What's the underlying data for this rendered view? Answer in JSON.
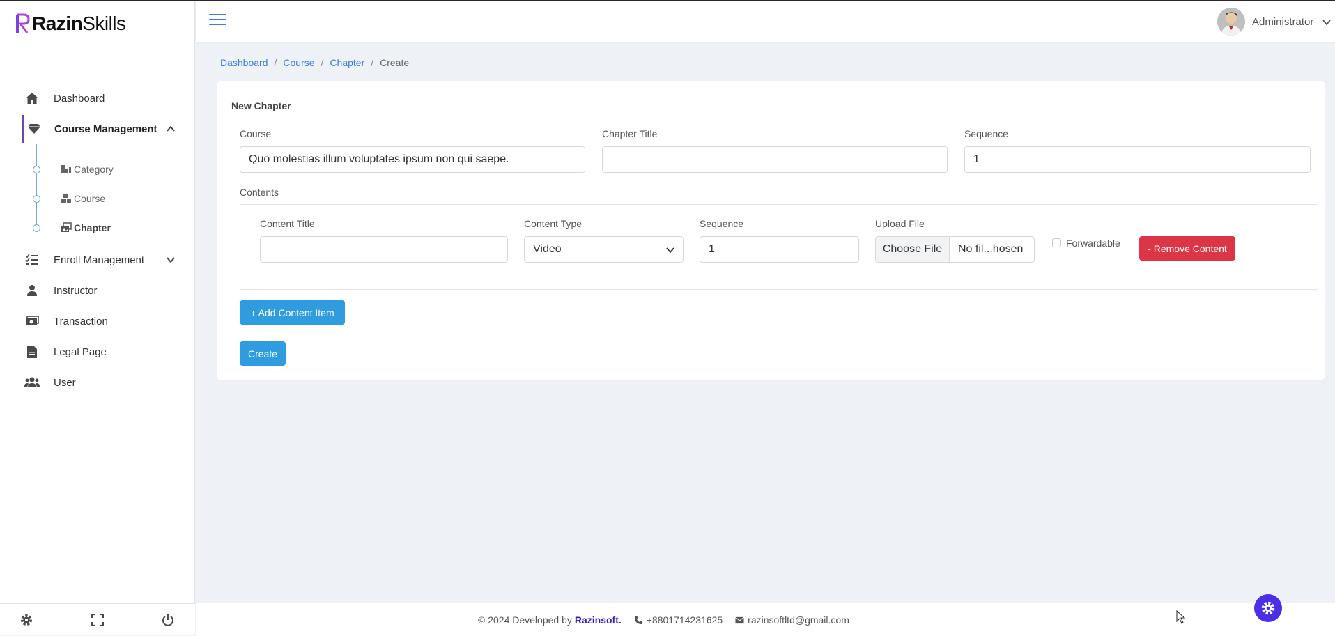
{
  "app": {
    "logo_brand": "Razin",
    "logo_suffix": "Skills"
  },
  "sidebar": {
    "items": [
      {
        "label": "Dashboard",
        "icon": "home-icon"
      },
      {
        "label": "Course Management",
        "icon": "gem-icon",
        "expanded": true
      },
      {
        "label": "Enroll Management",
        "icon": "list-check-icon",
        "expanded": false
      },
      {
        "label": "Instructor",
        "icon": "user-icon"
      },
      {
        "label": "Transaction",
        "icon": "money-icon"
      },
      {
        "label": "Legal Page",
        "icon": "file-icon"
      },
      {
        "label": "User",
        "icon": "users-icon"
      }
    ],
    "sub_items": [
      {
        "label": "Category",
        "icon": "category-icon"
      },
      {
        "label": "Course",
        "icon": "boxes-icon"
      },
      {
        "label": "Chapter",
        "icon": "images-icon",
        "active": true
      }
    ]
  },
  "topbar": {
    "user_name": "Administrator"
  },
  "breadcrumb": {
    "items": [
      "Dashboard",
      "Course",
      "Chapter"
    ],
    "current": "Create"
  },
  "form": {
    "title": "New Chapter",
    "course_label": "Course",
    "course_value": "Quo molestias illum voluptates ipsum non qui saepe.",
    "chapter_title_label": "Chapter Title",
    "chapter_title_value": "",
    "sequence_label": "Sequence",
    "sequence_value": "1",
    "contents_label": "Contents",
    "content_item": {
      "title_label": "Content Title",
      "title_value": "",
      "type_label": "Content Type",
      "type_value": "Video",
      "sequence_label": "Sequence",
      "sequence_value": "1",
      "upload_label": "Upload File",
      "choose_file": "Choose File",
      "file_name": "No fil...hosen",
      "forwardable_label": "Forwardable",
      "forwardable_checked": false,
      "remove_label": "- Remove Content"
    },
    "add_content_label": "+ Add Content Item",
    "create_label": "Create"
  },
  "footer": {
    "copyright": "© 2024 Developed by",
    "company": "Razinsoft.",
    "phone": "+8801714231625",
    "email": "razinsoftltd@gmail.com"
  },
  "colors": {
    "accent_blue": "#3d7ae6",
    "primary_button": "#2e9cdf",
    "danger_button": "#dc3545",
    "brand_purple": "#6f42c1",
    "fab": "#4b2ee8"
  }
}
